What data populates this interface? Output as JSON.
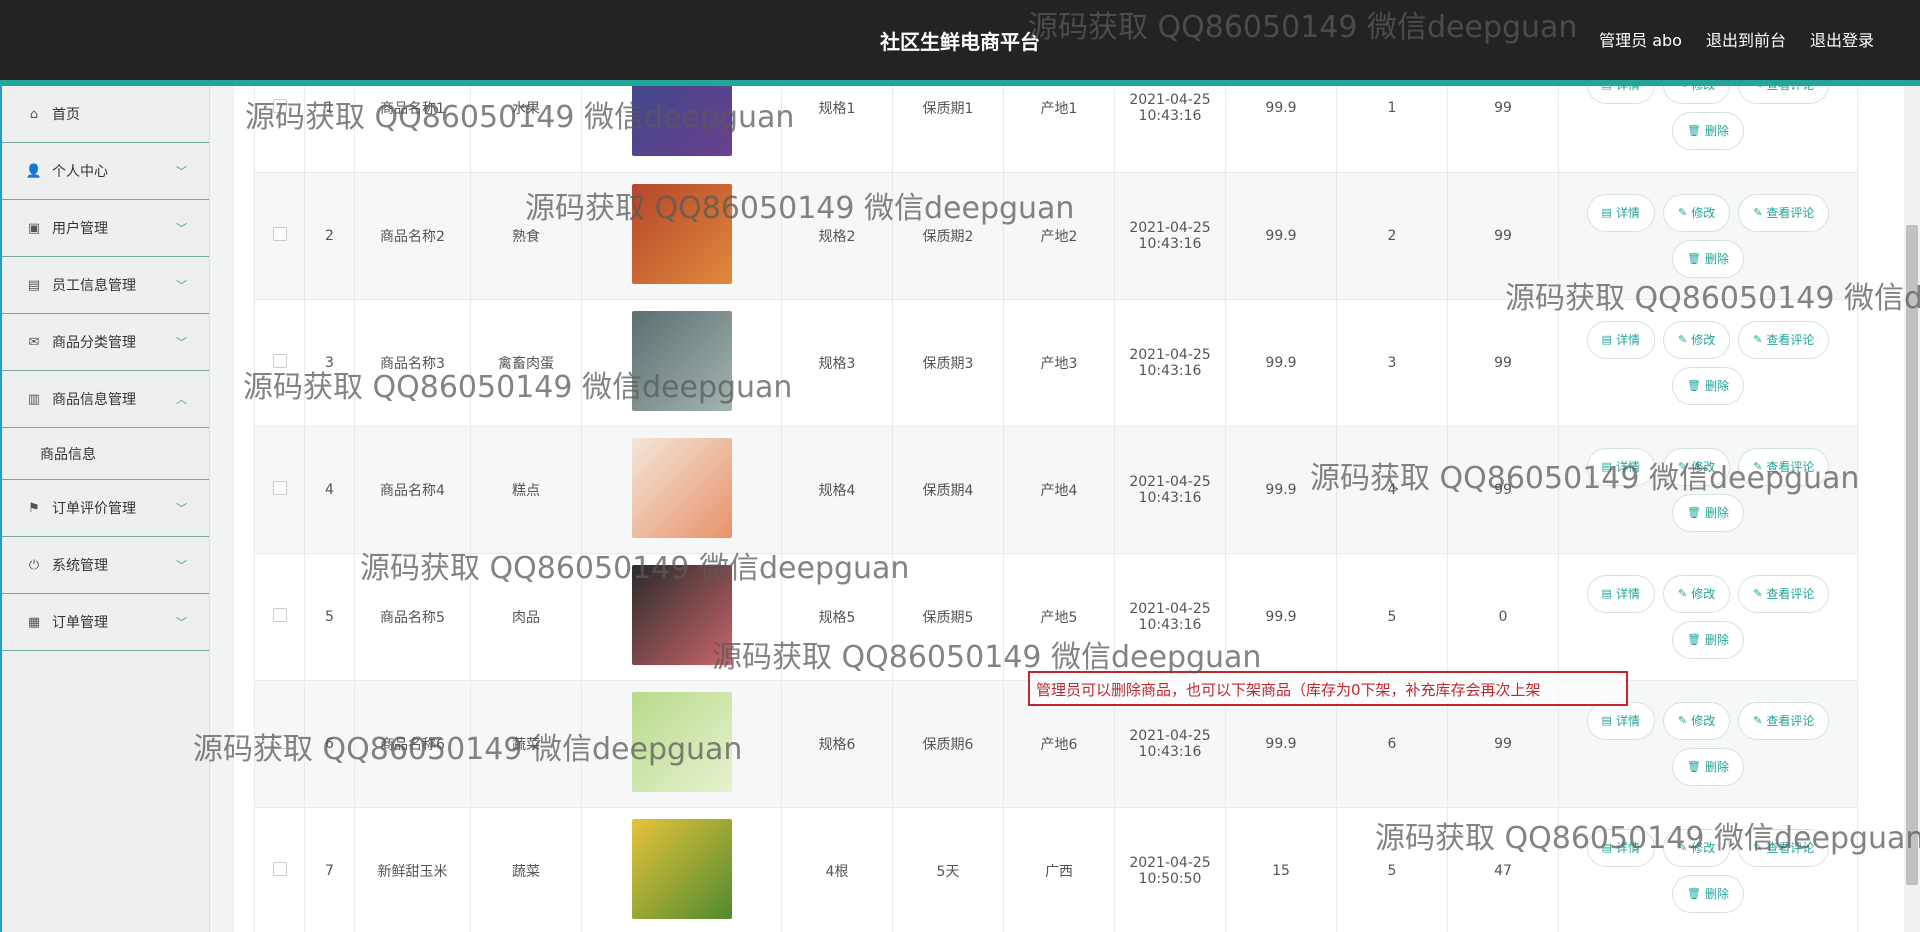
{
  "header": {
    "title": "社区生鲜电商平台",
    "nav": [
      "管理员 abo",
      "退出到前台",
      "退出登录"
    ]
  },
  "sidebar": {
    "items": [
      {
        "label": "首页",
        "icon": "home-icon",
        "glyph": "⌂",
        "chevron": ""
      },
      {
        "label": "个人中心",
        "icon": "user-icon",
        "glyph": "👤",
        "chevron": "﹀"
      },
      {
        "label": "用户管理",
        "icon": "clipboard-icon",
        "glyph": "▣",
        "chevron": "﹀"
      },
      {
        "label": "员工信息管理",
        "icon": "briefcase-icon",
        "glyph": "▤",
        "chevron": "﹀"
      },
      {
        "label": "商品分类管理",
        "icon": "mail-icon",
        "glyph": "✉",
        "chevron": "﹀"
      },
      {
        "label": "商品信息管理",
        "icon": "document-icon",
        "glyph": "▥",
        "chevron": "︿"
      },
      {
        "label": "订单评价管理",
        "icon": "flag-icon",
        "glyph": "⚑",
        "chevron": "﹀"
      },
      {
        "label": "系统管理",
        "icon": "power-icon",
        "glyph": "⏻",
        "chevron": "﹀"
      },
      {
        "label": "订单管理",
        "icon": "bar-chart-icon",
        "glyph": "▦",
        "chevron": "﹀"
      }
    ],
    "submenu": {
      "label": "商品信息"
    }
  },
  "table": {
    "rows": [
      {
        "idx": "1",
        "name": "商品名称1",
        "category": "水果",
        "spec": "规格1",
        "shelf": "保质期1",
        "origin": "产地1",
        "date": "2021-04-25",
        "time": "10:43:16",
        "price": "99.9",
        "qty": "1",
        "stock": "99",
        "img": [
          "#3a4a8a",
          "#6b3f8f"
        ]
      },
      {
        "idx": "2",
        "name": "商品名称2",
        "category": "熟食",
        "spec": "规格2",
        "shelf": "保质期2",
        "origin": "产地2",
        "date": "2021-04-25",
        "time": "10:43:16",
        "price": "99.9",
        "qty": "2",
        "stock": "99",
        "img": [
          "#b5462a",
          "#e08a3c"
        ]
      },
      {
        "idx": "3",
        "name": "商品名称3",
        "category": "禽畜肉蛋",
        "spec": "规格3",
        "shelf": "保质期3",
        "origin": "产地3",
        "date": "2021-04-25",
        "time": "10:43:16",
        "price": "99.9",
        "qty": "3",
        "stock": "99",
        "img": [
          "#5d6e70",
          "#a4b4b2"
        ]
      },
      {
        "idx": "4",
        "name": "商品名称4",
        "category": "糕点",
        "spec": "规格4",
        "shelf": "保质期4",
        "origin": "产地4",
        "date": "2021-04-25",
        "time": "10:43:16",
        "price": "99.9",
        "qty": "4",
        "stock": "99",
        "img": [
          "#f3e6d8",
          "#e8926a"
        ]
      },
      {
        "idx": "5",
        "name": "商品名称5",
        "category": "肉品",
        "spec": "规格5",
        "shelf": "保质期5",
        "origin": "产地5",
        "date": "2021-04-25",
        "time": "10:43:16",
        "price": "99.9",
        "qty": "5",
        "stock": "0",
        "img": [
          "#2b2b2b",
          "#c9656a"
        ]
      },
      {
        "idx": "6",
        "name": "商品名称6",
        "category": "蔬菜",
        "spec": "规格6",
        "shelf": "保质期6",
        "origin": "产地6",
        "date": "2021-04-25",
        "time": "10:43:16",
        "price": "99.9",
        "qty": "6",
        "stock": "99",
        "img": [
          "#b9d98a",
          "#e6f2cf"
        ]
      },
      {
        "idx": "7",
        "name": "新鲜甜玉米",
        "category": "蔬菜",
        "spec": "4根",
        "shelf": "5天",
        "origin": "广西",
        "date": "2021-04-25",
        "time": "10:50:50",
        "price": "15",
        "qty": "5",
        "stock": "47",
        "img": [
          "#e6c43a",
          "#4f8a2f"
        ]
      }
    ],
    "actions": {
      "detail": "详情",
      "edit": "修改",
      "review": "查看评论",
      "delete": "删除"
    }
  },
  "annotation": "管理员可以删除商品，也可以下架商品（库存为0下架，补充库存会再次上架",
  "watermark": "源码获取 QQ86050149 微信deepguan",
  "colors": {
    "header_bg": "#232323",
    "accent": "#23a59a",
    "annotation": "#c0282e"
  }
}
